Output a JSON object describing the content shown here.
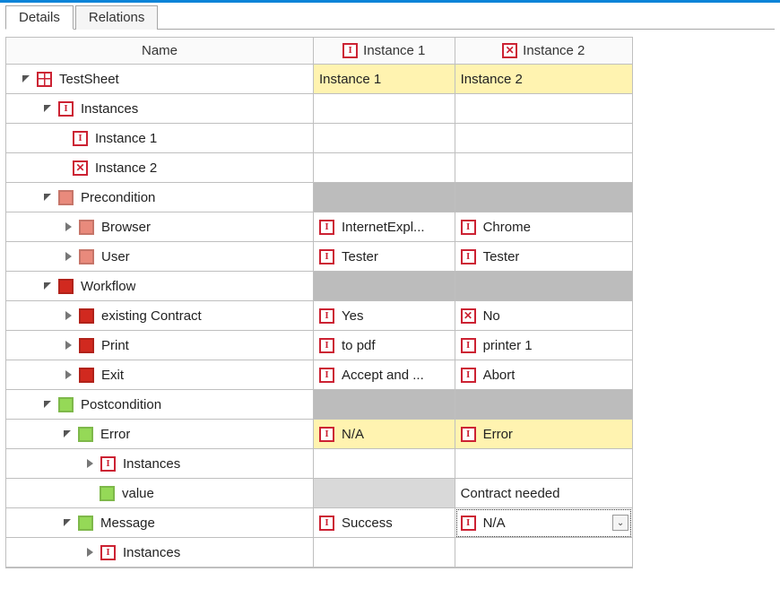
{
  "tabs": {
    "details": "Details",
    "relations": "Relations"
  },
  "columns": {
    "name": "Name",
    "instance1": "Instance 1",
    "instance2": "Instance 2"
  },
  "tree": {
    "testsheet": {
      "label": "TestSheet",
      "inst1": "Instance 1",
      "inst2": "Instance 2"
    },
    "instances": {
      "label": "Instances",
      "item1": "Instance 1",
      "item2": "Instance 2"
    },
    "precondition": {
      "label": "Precondition",
      "browser": {
        "label": "Browser",
        "inst1": "InternetExpl...",
        "inst2": "Chrome"
      },
      "user": {
        "label": "User",
        "inst1": "Tester",
        "inst2": "Tester"
      }
    },
    "workflow": {
      "label": "Workflow",
      "existing": {
        "label": "existing Contract",
        "inst1": "Yes",
        "inst2": "No"
      },
      "print": {
        "label": "Print",
        "inst1": "to pdf",
        "inst2": "printer 1"
      },
      "exit": {
        "label": "Exit",
        "inst1": "Accept and ...",
        "inst2": "Abort"
      }
    },
    "postcondition": {
      "label": "Postcondition",
      "error": {
        "label": "Error",
        "inst1": "N/A",
        "inst2": "Error",
        "instances": "Instances",
        "value_label": "value",
        "value_inst2": "Contract needed"
      },
      "message": {
        "label": "Message",
        "inst1": "Success",
        "inst2": "N/A",
        "instances": "Instances"
      }
    }
  }
}
